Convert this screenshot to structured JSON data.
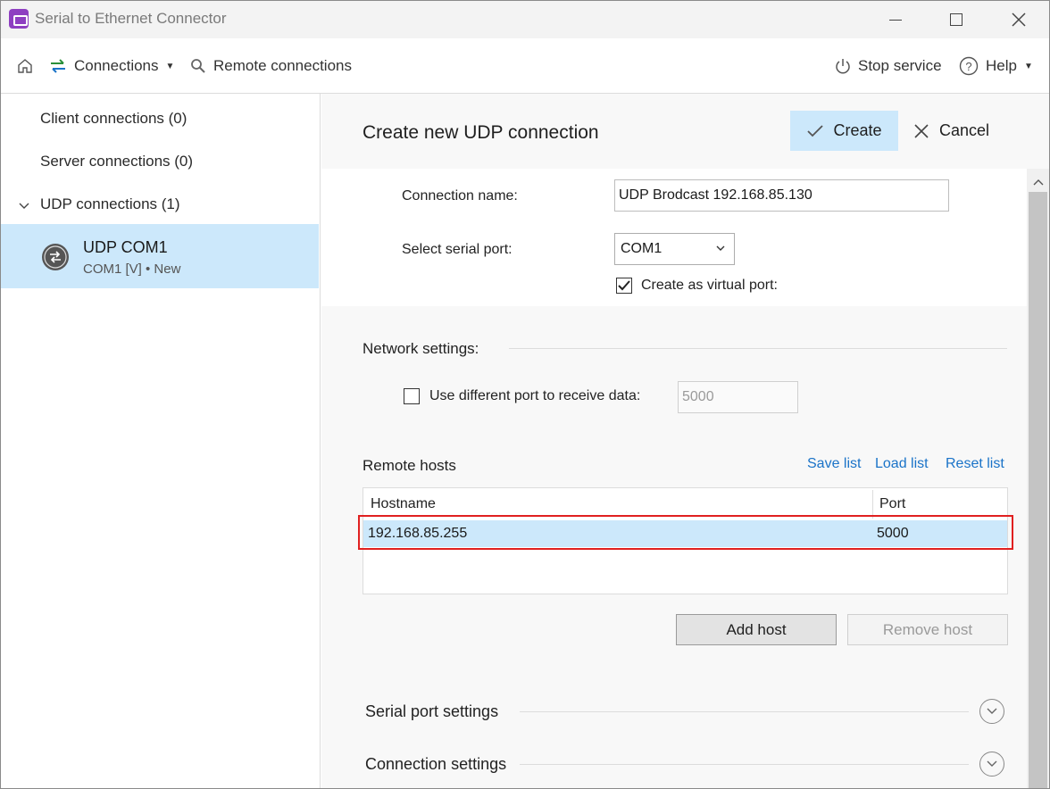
{
  "window": {
    "title": "Serial to Ethernet Connector"
  },
  "toolbar": {
    "connections_label": "Connections",
    "remote_label": "Remote connections",
    "stop_label": "Stop service",
    "help_label": "Help"
  },
  "sidebar": {
    "client_label": "Client connections (0)",
    "server_label": "Server connections (0)",
    "udp_label": "UDP connections (1)",
    "selected": {
      "title": "UDP COM1",
      "subtitle": "COM1 [V] • New"
    }
  },
  "main": {
    "title": "Create new UDP connection",
    "create_label": "Create",
    "cancel_label": "Cancel",
    "connection_name_label": "Connection name:",
    "connection_name_value": "UDP Brodcast 192.168.85.130",
    "serial_port_label": "Select serial port:",
    "serial_port_value": "COM1",
    "virtual_port_label": "Create as virtual port:",
    "virtual_port_checked": true,
    "network_title": "Network settings:",
    "diff_port_label": "Use different port to receive data:",
    "diff_port_checked": false,
    "diff_port_value": "5000",
    "remote_hosts_title": "Remote hosts",
    "save_list": "Save list",
    "load_list": "Load list",
    "reset_list": "Reset list",
    "table": {
      "columns": [
        "Hostname",
        "Port"
      ],
      "rows": [
        {
          "hostname": "192.168.85.255",
          "port": "5000"
        }
      ]
    },
    "add_host_label": "Add host",
    "remove_host_label": "Remove host",
    "serial_settings_title": "Serial port settings",
    "connection_settings_title": "Connection settings"
  },
  "colors": {
    "accent_selection": "#cce8fb",
    "link": "#1a73c8",
    "highlight_border": "#e02020",
    "app_icon": "#8e3fc1"
  }
}
